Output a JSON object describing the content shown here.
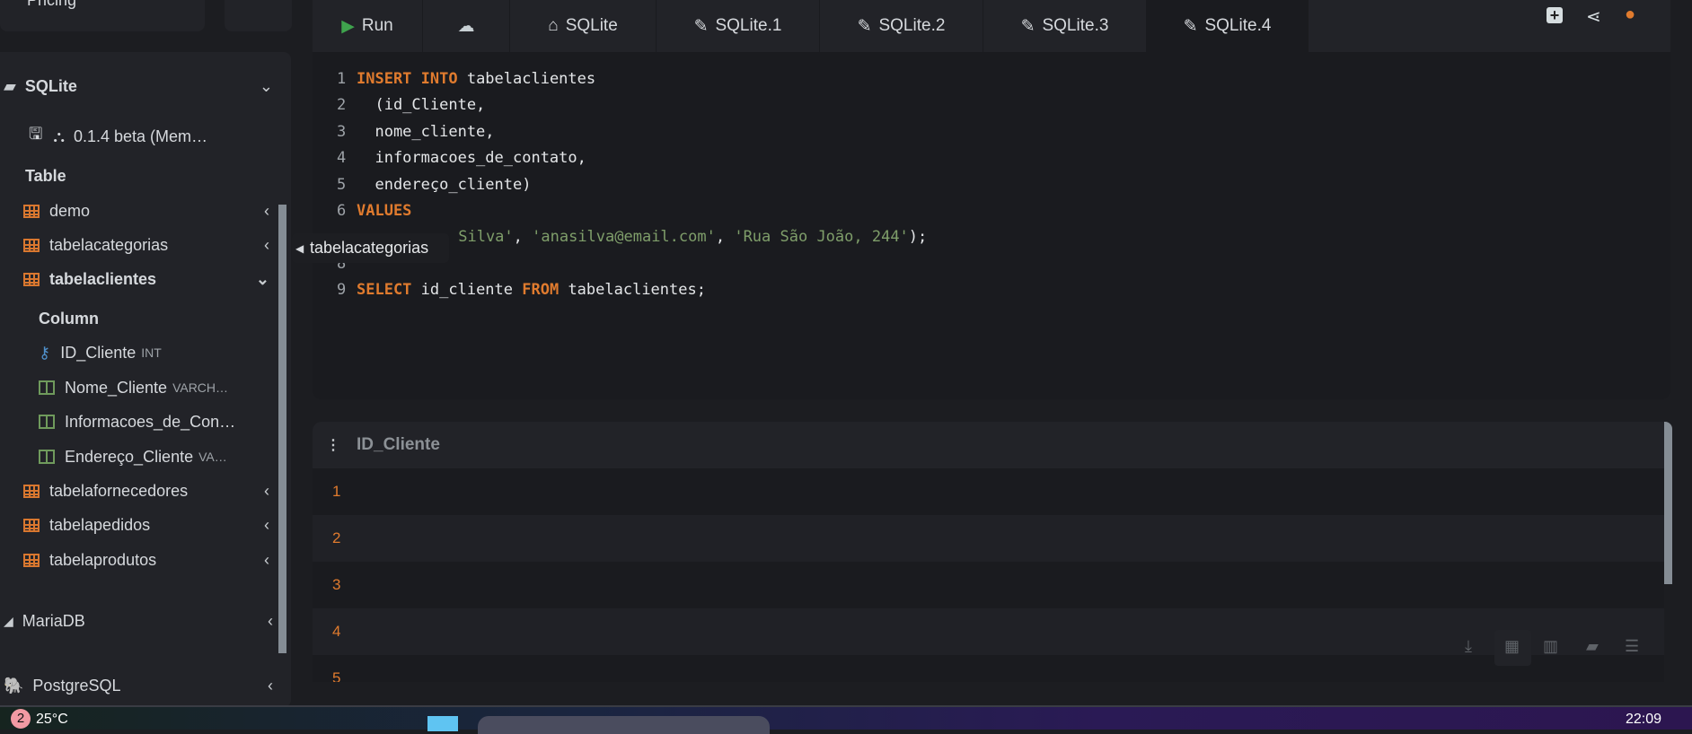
{
  "top_cards": {
    "pricing_label": "Pricing"
  },
  "sidebar": {
    "sqlite": {
      "label": "SQLite",
      "version": "0.1.4 beta (Mem…",
      "table_heading": "Table"
    },
    "tables": [
      {
        "label": "demo",
        "expanded": false
      },
      {
        "label": "tabelacategorias",
        "expanded": false
      },
      {
        "label": "tabelaclientes",
        "expanded": true
      }
    ],
    "column_heading": "Column",
    "columns": [
      {
        "name": "ID_Cliente",
        "type": "INT",
        "icon": "key-icon"
      },
      {
        "name": "Nome_Cliente",
        "type": "VARCH…",
        "icon": "column-icon"
      },
      {
        "name": "Informacoes_de_Con…",
        "type": "",
        "icon": "column-icon"
      },
      {
        "name": "Endereço_Cliente",
        "type": "VA…",
        "icon": "column-icon"
      }
    ],
    "more_tables": [
      "tabelafornecedores",
      "tabelapedidos",
      "tabelaprodutos"
    ],
    "databases": [
      "MariaDB",
      "PostgreSQL"
    ]
  },
  "tooltip": "tabelacategorias",
  "toolbar": {
    "run": "Run",
    "tabs": [
      "SQLite",
      "SQLite.1",
      "SQLite.2",
      "SQLite.3",
      "SQLite.4"
    ],
    "active_tab": "SQLite.4"
  },
  "editor": {
    "lines": [
      "INSERT INTO tabelaclientes",
      "  (id_Cliente,",
      "  nome_cliente,",
      "  informacoes_de_contato,",
      "  endereço_cliente)",
      "VALUES",
      " Silva', 'anasilva@email.com', 'Rua São João, 244');",
      "",
      "SELECT id_cliente FROM tabelaclientes;"
    ]
  },
  "results": {
    "column": "ID_Cliente",
    "rows": [
      "1",
      "2",
      "3",
      "4",
      "5"
    ]
  },
  "taskbar": {
    "badge": "2",
    "weather": "25°C",
    "time": "22:09"
  },
  "colors": {
    "accent": "#e07b2e",
    "run": "#3fa34d",
    "bg": "#1c1d21"
  }
}
